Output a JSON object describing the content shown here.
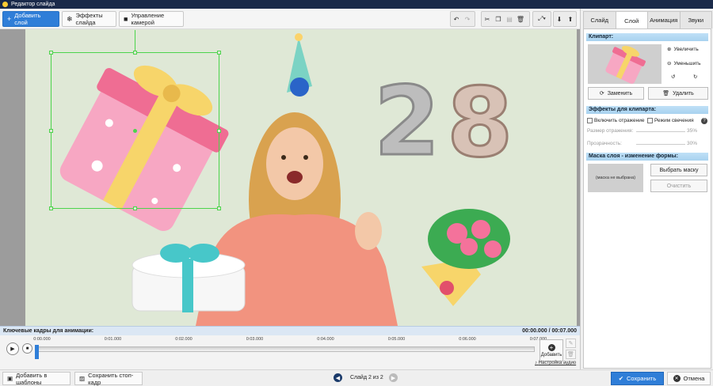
{
  "window": {
    "title": "Редактор слайда"
  },
  "toolbar": {
    "add_layer": "Добавить слой",
    "slide_effects": "Эффекты слайда",
    "camera_control": "Управление камерой"
  },
  "keyframes": {
    "title": "Ключевые кадры для анимации:",
    "time_current": "00:00.000",
    "time_sep": "/",
    "time_total": "00:07.000",
    "ticks": [
      "0:00.000",
      "0:01.000",
      "0:02.000",
      "0:03.000",
      "0:04.000",
      "0:05.000",
      "0:06.000",
      "0:07.000"
    ],
    "add_label": "Добавить",
    "audio_settings": "Настройка аудио"
  },
  "bottom": {
    "add_to_templates": "Добавить в шаблоны",
    "save_frame": "Сохранить стоп-кадр",
    "slide_label": "Слайд 2 из 2",
    "save": "Сохранить",
    "cancel": "Отмена"
  },
  "panel": {
    "tabs": [
      "Слайд",
      "Слой",
      "Анимация",
      "Звуки"
    ],
    "active_tab": "Слой",
    "clipart_header": "Клипарт:",
    "zoom_in": "Увеличить",
    "zoom_out": "Уменьшить",
    "replace": "Заменить",
    "delete": "Удалить",
    "clip_effects_header": "Эффекты для клипарта:",
    "reflection": "Включить отражение",
    "glow": "Режим свечения",
    "reflection_size_label": "Размер отражения:",
    "reflection_size_value": "35%",
    "transparency_label": "Прозрачность:",
    "transparency_value": "30%",
    "mask_header": "Маска слоя - изменение формы:",
    "mask_not_selected": "(маска не выбрана)",
    "choose_mask": "Выбрать маску",
    "clear": "Очистить"
  },
  "colors": {
    "accent": "#2f7ed8",
    "selection": "#4cd44c",
    "section": "#a8d2ef"
  }
}
